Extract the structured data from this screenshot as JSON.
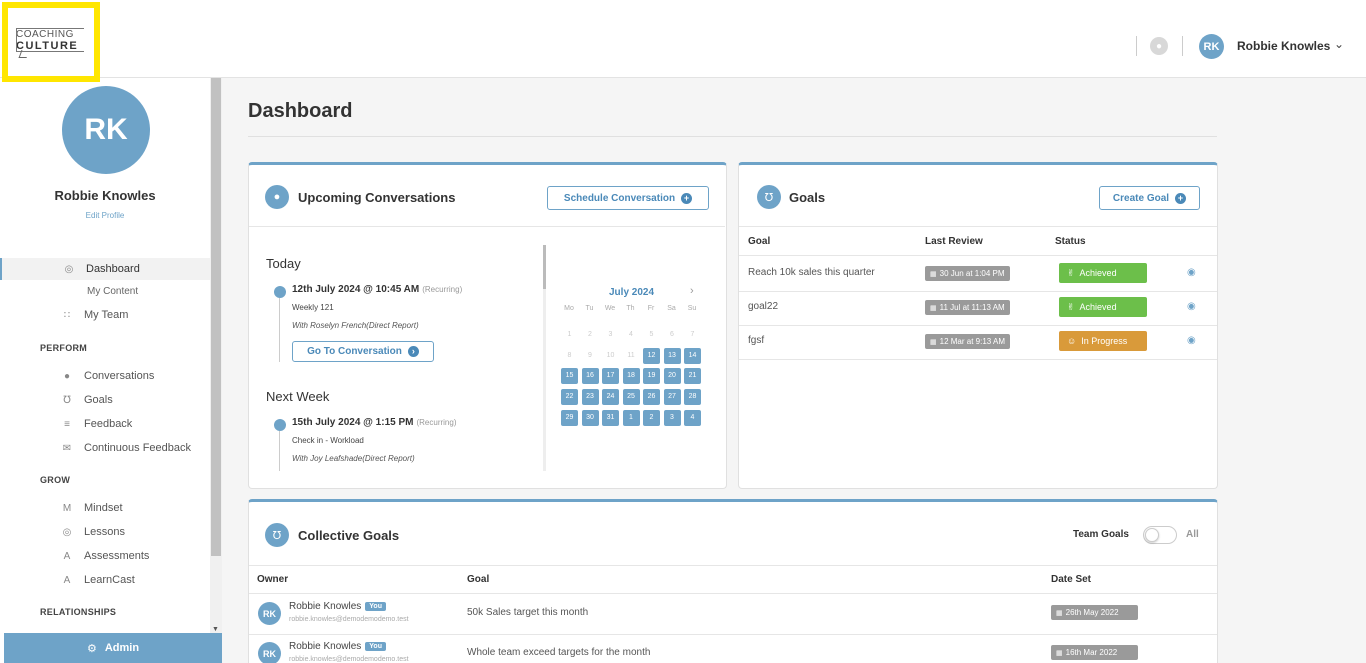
{
  "brand": {
    "logo_line1": "COACHING",
    "logo_line2": "CULTURE"
  },
  "header": {
    "avatar_initials": "RK",
    "user_name": "Robbie Knowles"
  },
  "sidebar": {
    "avatar_initials": "RK",
    "name": "Robbie Knowles",
    "edit_profile": "Edit Profile",
    "dashboard": "Dashboard",
    "my_content": "My Content",
    "my_team": "My Team",
    "perform": "PERFORM",
    "conversations": "Conversations",
    "goals": "Goals",
    "feedback": "Feedback",
    "continuous_feedback": "Continuous Feedback",
    "grow": "GROW",
    "mindset": "Mindset",
    "lessons": "Lessons",
    "assessments": "Assessments",
    "learncast": "LearnCast",
    "relationships": "RELATIONSHIPS",
    "admin": "Admin"
  },
  "page": {
    "title": "Dashboard"
  },
  "conversations": {
    "title": "Upcoming Conversations",
    "schedule_btn": "Schedule Conversation",
    "groups": [
      {
        "label": "Today",
        "date": "12th July 2024 @ 10:45 AM",
        "recurring": "(Recurring)",
        "name": "Weekly 121",
        "with": "With Roselyn French(Direct Report)",
        "action": "Go To Conversation"
      },
      {
        "label": "Next Week",
        "date": "15th July 2024 @ 1:15 PM",
        "recurring": "(Recurring)",
        "name": "Check in - Workload",
        "with": "With Joy Leafshade(Direct Report)"
      }
    ]
  },
  "calendar": {
    "month": "July 2024",
    "weekdays": [
      "Mo",
      "Tu",
      "We",
      "Th",
      "Fr",
      "Sa",
      "Su"
    ],
    "rows": [
      [
        "1",
        "2",
        "3",
        "4",
        "5",
        "6",
        "7"
      ],
      [
        "8",
        "9",
        "10",
        "11",
        "12",
        "13",
        "14"
      ],
      [
        "15",
        "16",
        "17",
        "18",
        "19",
        "20",
        "21"
      ],
      [
        "22",
        "23",
        "24",
        "25",
        "26",
        "27",
        "28"
      ],
      [
        "29",
        "30",
        "31",
        "1",
        "2",
        "3",
        "4"
      ]
    ]
  },
  "goals": {
    "title": "Goals",
    "create_btn": "Create Goal",
    "columns": [
      "Goal",
      "Last Review",
      "Status"
    ],
    "rows": [
      {
        "goal": "Reach 10k sales this quarter",
        "review": "30 Jun at 1:04 PM",
        "status": "Achieved",
        "color": "#6cbf4a"
      },
      {
        "goal": "goal22",
        "review": "11 Jul at 11:13 AM",
        "status": "Achieved",
        "color": "#6cbf4a"
      },
      {
        "goal": "fgsf",
        "review": "12 Mar at 9:13 AM",
        "status": "In Progress",
        "color": "#d99a3a"
      }
    ]
  },
  "collective": {
    "title": "Collective Goals",
    "team_goals": "Team Goals",
    "all": "All",
    "columns": [
      "Owner",
      "Goal",
      "Date Set"
    ],
    "rows": [
      {
        "initials": "RK",
        "owner": "Robbie Knowles",
        "you": "You",
        "email": "robbie.knowles@demodemodemo.test",
        "goal": "50k Sales target this month",
        "date": "26th May 2022"
      },
      {
        "initials": "RK",
        "owner": "Robbie Knowles",
        "you": "You",
        "email": "robbie.knowles@demodemodemo.test",
        "goal": "Whole team exceed targets for the month",
        "date": "16th Mar 2022"
      }
    ]
  },
  "colors": {
    "accent": "#6ea3c8",
    "achieved": "#6cbf4a",
    "in_progress": "#d99a3a",
    "highlight": "#ffe600"
  }
}
